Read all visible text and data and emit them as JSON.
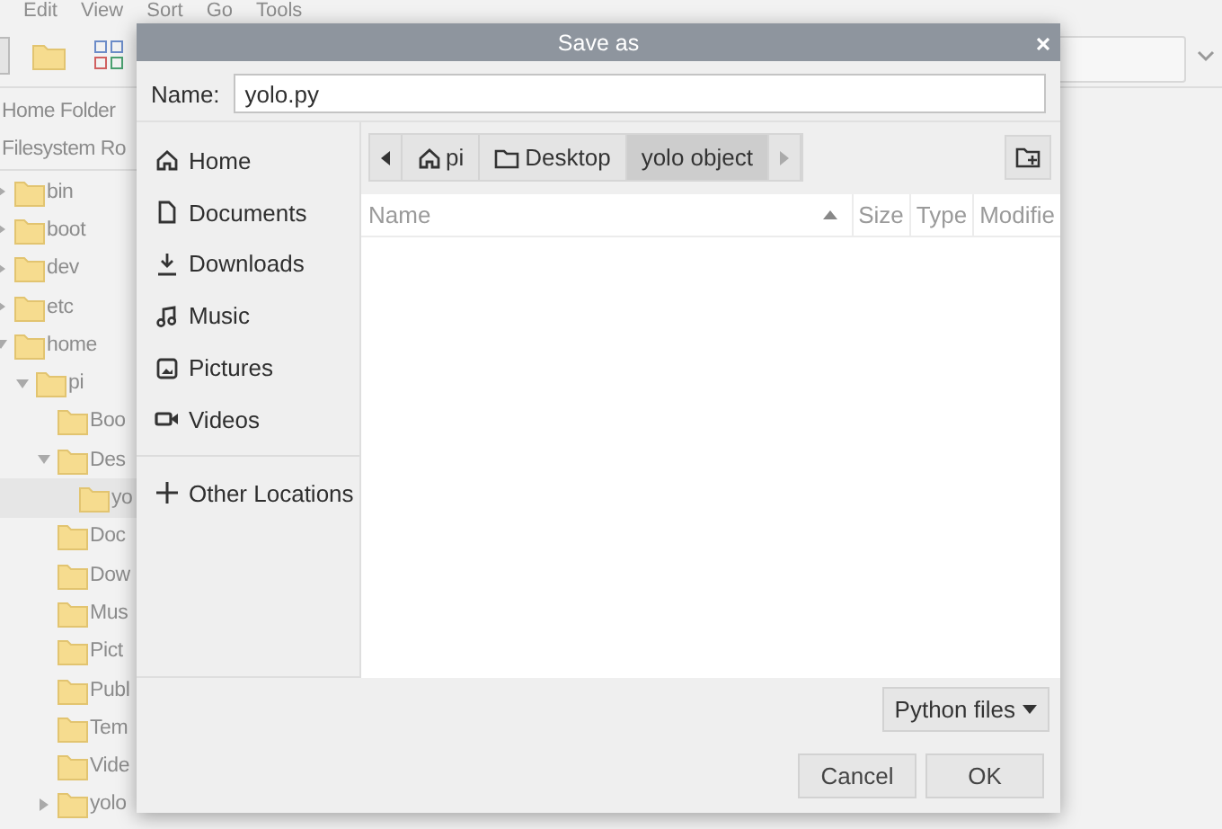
{
  "background_window": {
    "menu": [
      "Edit",
      "View",
      "Sort",
      "Go",
      "Tools"
    ],
    "places": [
      "Home Folder",
      "Filesystem Ro"
    ],
    "tree": [
      {
        "label": "bin",
        "expanded": false,
        "selected": false
      },
      {
        "label": "boot",
        "expanded": false,
        "selected": false
      },
      {
        "label": "dev",
        "expanded": false,
        "selected": false
      },
      {
        "label": "etc",
        "expanded": false,
        "selected": false
      },
      {
        "label": "home",
        "expanded": true,
        "selected": false,
        "children": [
          {
            "label": "pi",
            "expanded": true,
            "selected": false,
            "children": [
              {
                "label": "Boo",
                "selected": false
              },
              {
                "label": "Des",
                "expanded": true,
                "selected": false,
                "children": [
                  {
                    "label": "yo",
                    "selected": true
                  }
                ]
              },
              {
                "label": "Doc",
                "selected": false
              },
              {
                "label": "Dow",
                "selected": false
              },
              {
                "label": "Mus",
                "selected": false
              },
              {
                "label": "Pict",
                "selected": false
              },
              {
                "label": "Publ",
                "selected": false
              },
              {
                "label": "Tem",
                "selected": false
              },
              {
                "label": "Vide",
                "selected": false
              },
              {
                "label": "yolo",
                "expanded": false,
                "selected": false
              }
            ]
          }
        ]
      }
    ]
  },
  "dialog": {
    "title": "Save as",
    "name_label": "Name:",
    "name_value": "yolo.py",
    "places": [
      "Home",
      "Documents",
      "Downloads",
      "Music",
      "Pictures",
      "Videos"
    ],
    "other_locations": "Other Locations",
    "path": [
      {
        "label": "pi",
        "selected": false
      },
      {
        "label": "Desktop",
        "selected": false
      },
      {
        "label": "yolo object",
        "selected": true
      }
    ],
    "columns": [
      "Name",
      "Size",
      "Type",
      "Modifie"
    ],
    "filter": "Python files",
    "buttons": [
      "Cancel",
      "OK"
    ]
  }
}
